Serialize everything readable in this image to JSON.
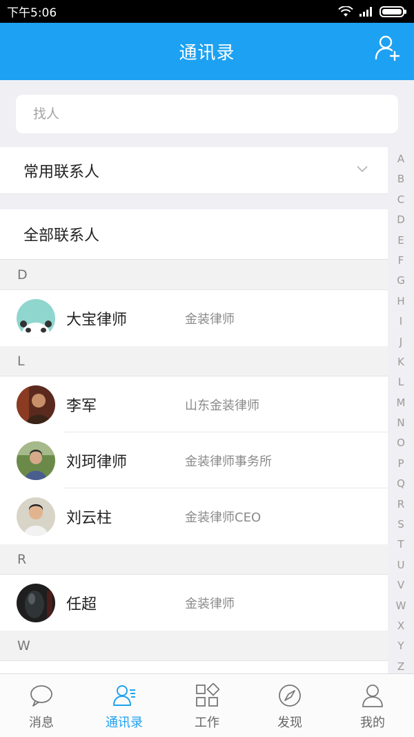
{
  "status_bar": {
    "time": "下午5:06"
  },
  "header": {
    "title": "通讯录"
  },
  "search": {
    "placeholder": "找人"
  },
  "groups": {
    "frequent": "常用联系人",
    "all": "全部联系人"
  },
  "sections": [
    {
      "letter": "D",
      "contacts": [
        {
          "name": "大宝律师",
          "org": "金装律师"
        }
      ]
    },
    {
      "letter": "L",
      "contacts": [
        {
          "name": "李军",
          "org": "山东金装律师"
        },
        {
          "name": "刘珂律师",
          "org": "金装律师事务所"
        },
        {
          "name": "刘云柱",
          "org": "金装律师CEO"
        }
      ]
    },
    {
      "letter": "R",
      "contacts": [
        {
          "name": "任超",
          "org": "金装律师"
        }
      ]
    },
    {
      "letter": "W",
      "contacts": []
    }
  ],
  "index_letters": [
    "A",
    "B",
    "C",
    "D",
    "E",
    "F",
    "G",
    "H",
    "I",
    "J",
    "K",
    "L",
    "M",
    "N",
    "O",
    "P",
    "Q",
    "R",
    "S",
    "T",
    "U",
    "V",
    "W",
    "X",
    "Y",
    "Z"
  ],
  "tabs": [
    {
      "label": "消息",
      "icon": "message-icon"
    },
    {
      "label": "通讯录",
      "icon": "contacts-icon",
      "active": true
    },
    {
      "label": "工作",
      "icon": "apps-grid-icon"
    },
    {
      "label": "发现",
      "icon": "compass-icon"
    },
    {
      "label": "我的",
      "icon": "profile-icon"
    }
  ],
  "colors": {
    "accent": "#1da1f2",
    "background": "#efeff4"
  }
}
